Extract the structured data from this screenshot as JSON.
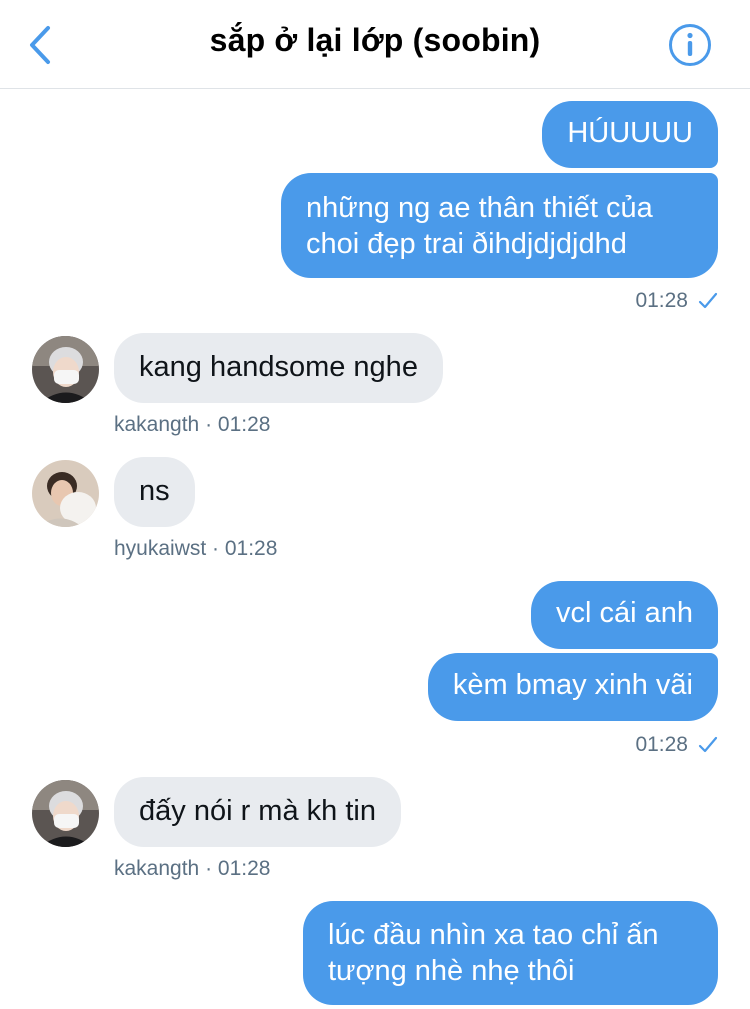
{
  "header": {
    "title": "sắp ở lại lớp (soobin)"
  },
  "colors": {
    "accent": "#4a9aea",
    "incoming_bubble": "#e8ebef",
    "meta_text": "#5b7083"
  },
  "messages": {
    "m1": "HÚUUUU",
    "m2": "những ng ae thân thiết của choi đẹp trai ðihdjdjdjdhd",
    "meta1": "01:28",
    "m3": "kang handsome nghe",
    "meta2": "kakangth · 01:28",
    "m4": "ns",
    "meta3": "hyukaiwst · 01:28",
    "m5": "vcl cái anh",
    "m6": "kèm bmay xinh vãi",
    "meta4": "01:28",
    "m7": "đấy nói r mà kh tin",
    "meta5": "kakangth · 01:28",
    "m8": "lúc đầu nhìn xa tao chỉ ấn tượng nhè nhẹ thôi"
  },
  "icons": {
    "back": "chevron-left-icon",
    "info": "info-icon",
    "read": "checkmark-icon"
  }
}
